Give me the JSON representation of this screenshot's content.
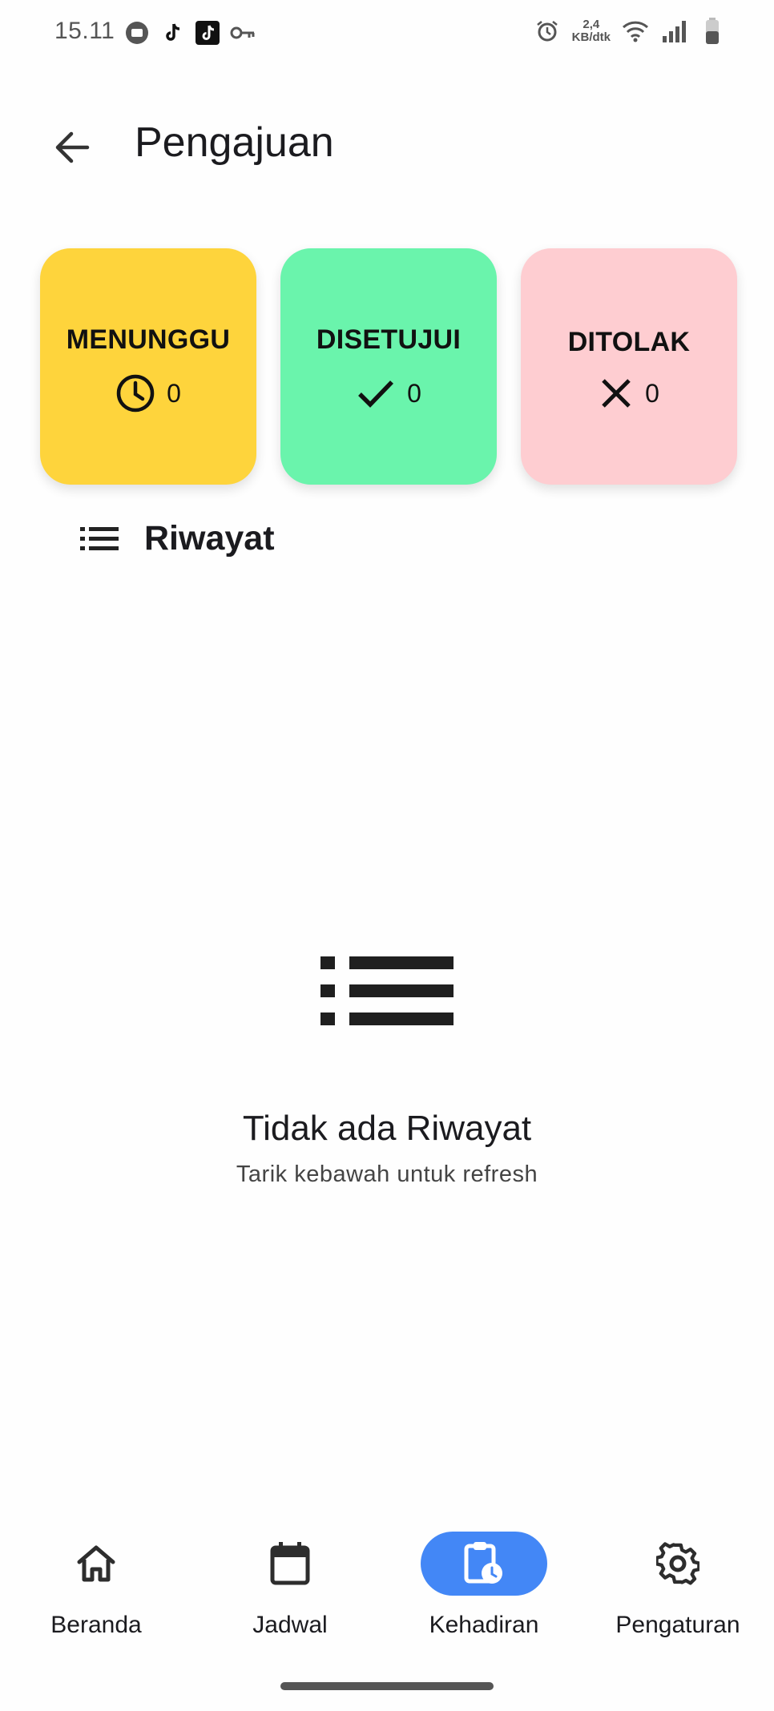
{
  "status_bar": {
    "time": "15.11",
    "network_speed_value": "2,4",
    "network_speed_unit": "KB/dtk"
  },
  "header": {
    "title": "Pengajuan"
  },
  "cards": [
    {
      "label": "MENUNGGU",
      "count": "0",
      "icon": "clock-icon",
      "color": "#fed43c"
    },
    {
      "label": "DISETUJUI",
      "count": "0",
      "icon": "check-icon",
      "color": "#6af4ac"
    },
    {
      "label": "DITOLAK",
      "count": "0",
      "icon": "close-icon",
      "color": "#fecdd1"
    }
  ],
  "history": {
    "title": "Riwayat",
    "icon": "list-icon"
  },
  "empty_state": {
    "title": "Tidak ada Riwayat",
    "subtitle": "Tarik kebawah untuk refresh",
    "icon": "list-icon"
  },
  "bottom_nav": {
    "items": [
      {
        "label": "Beranda",
        "icon": "home-icon",
        "active": false
      },
      {
        "label": "Jadwal",
        "icon": "calendar-icon",
        "active": false
      },
      {
        "label": "Kehadiran",
        "icon": "clipboard-clock-icon",
        "active": true
      },
      {
        "label": "Pengaturan",
        "icon": "gear-icon",
        "active": false
      }
    ],
    "active_color": "#4387f6"
  }
}
